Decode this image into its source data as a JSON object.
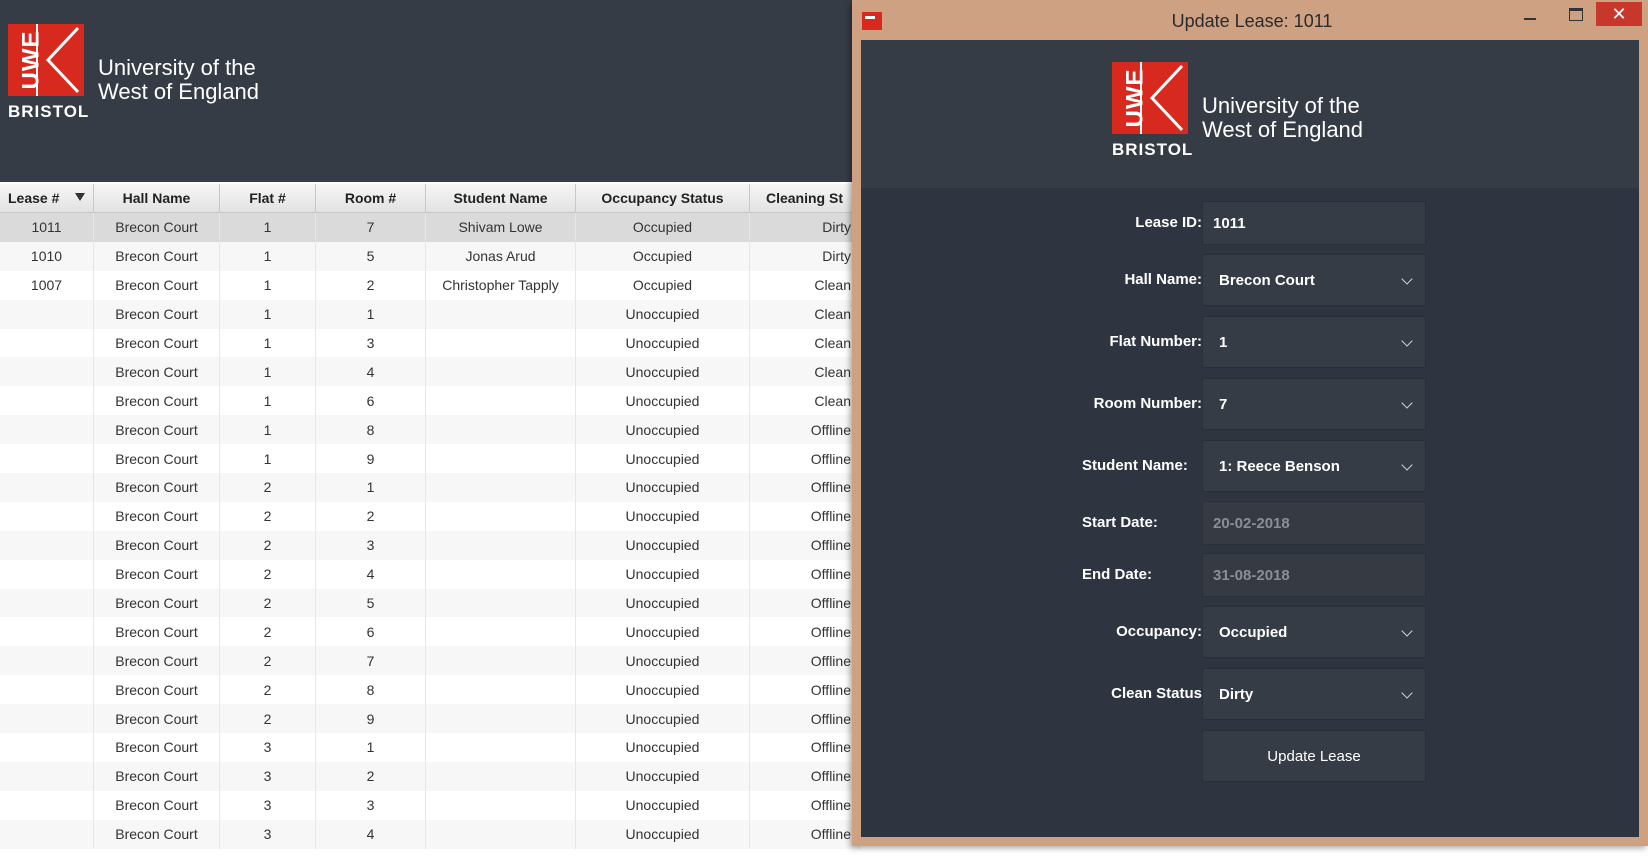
{
  "app": {
    "logo": {
      "mark_text": "UWE",
      "bristol": "BRISTOL",
      "university": "University of the\nWest of England"
    }
  },
  "table": {
    "columns": [
      "Lease #",
      "Hall Name",
      "Flat #",
      "Room #",
      "Student Name",
      "Occupancy Status",
      "Cleaning St"
    ],
    "rows": [
      [
        "1011",
        "Brecon Court",
        "1",
        "7",
        "Shivam Lowe",
        "Occupied",
        "Dirty"
      ],
      [
        "1010",
        "Brecon Court",
        "1",
        "5",
        "Jonas Arud",
        "Occupied",
        "Dirty"
      ],
      [
        "1007",
        "Brecon Court",
        "1",
        "2",
        "Christopher Tapply",
        "Occupied",
        "Clean"
      ],
      [
        "",
        "Brecon Court",
        "1",
        "1",
        "",
        "Unoccupied",
        "Clean"
      ],
      [
        "",
        "Brecon Court",
        "1",
        "3",
        "",
        "Unoccupied",
        "Clean"
      ],
      [
        "",
        "Brecon Court",
        "1",
        "4",
        "",
        "Unoccupied",
        "Clean"
      ],
      [
        "",
        "Brecon Court",
        "1",
        "6",
        "",
        "Unoccupied",
        "Clean"
      ],
      [
        "",
        "Brecon Court",
        "1",
        "8",
        "",
        "Unoccupied",
        "Offline"
      ],
      [
        "",
        "Brecon Court",
        "1",
        "9",
        "",
        "Unoccupied",
        "Offline"
      ],
      [
        "",
        "Brecon Court",
        "2",
        "1",
        "",
        "Unoccupied",
        "Offline"
      ],
      [
        "",
        "Brecon Court",
        "2",
        "2",
        "",
        "Unoccupied",
        "Offline"
      ],
      [
        "",
        "Brecon Court",
        "2",
        "3",
        "",
        "Unoccupied",
        "Offline"
      ],
      [
        "",
        "Brecon Court",
        "2",
        "4",
        "",
        "Unoccupied",
        "Offline"
      ],
      [
        "",
        "Brecon Court",
        "2",
        "5",
        "",
        "Unoccupied",
        "Offline"
      ],
      [
        "",
        "Brecon Court",
        "2",
        "6",
        "",
        "Unoccupied",
        "Offline"
      ],
      [
        "",
        "Brecon Court",
        "2",
        "7",
        "",
        "Unoccupied",
        "Offline"
      ],
      [
        "",
        "Brecon Court",
        "2",
        "8",
        "",
        "Unoccupied",
        "Offline"
      ],
      [
        "",
        "Brecon Court",
        "2",
        "9",
        "",
        "Unoccupied",
        "Offline"
      ],
      [
        "",
        "Brecon Court",
        "3",
        "1",
        "",
        "Unoccupied",
        "Offline"
      ],
      [
        "",
        "Brecon Court",
        "3",
        "2",
        "",
        "Unoccupied",
        "Offline"
      ],
      [
        "",
        "Brecon Court",
        "3",
        "3",
        "",
        "Unoccupied",
        "Offline"
      ],
      [
        "",
        "Brecon Court",
        "3",
        "4",
        "",
        "Unoccupied",
        "Offline"
      ]
    ],
    "selected_row": 0
  },
  "dialog": {
    "title": "Update Lease: 1011",
    "app_icon": "uwe-bristol-icon",
    "controls": {
      "minimize": "minimize-icon",
      "maximize": "maximize-icon",
      "close": "✕"
    },
    "form": {
      "lease_id": {
        "label": "Lease ID:",
        "value": "1011"
      },
      "hall_name": {
        "label": "Hall Name:",
        "value": "Brecon Court"
      },
      "flat_number": {
        "label": "Flat Number:",
        "value": "1"
      },
      "room_number": {
        "label": "Room Number:",
        "value": "7"
      },
      "student_name": {
        "label": "Student Name:",
        "value": "1: Reece Benson"
      },
      "start_date": {
        "label": "Start Date:",
        "value": "20-02-2018"
      },
      "end_date": {
        "label": "End Date:",
        "value": "31-08-2018"
      },
      "occupancy": {
        "label": "Occupancy:",
        "value": "Occupied"
      },
      "clean_status": {
        "label": "Clean Status",
        "value": "Dirty"
      },
      "submit_label": "Update Lease"
    }
  },
  "colors": {
    "brand_red": "#d8291f",
    "dark_bg": "#2f3540",
    "header_bg": "#363c46",
    "window_frame": "#cfa183"
  }
}
